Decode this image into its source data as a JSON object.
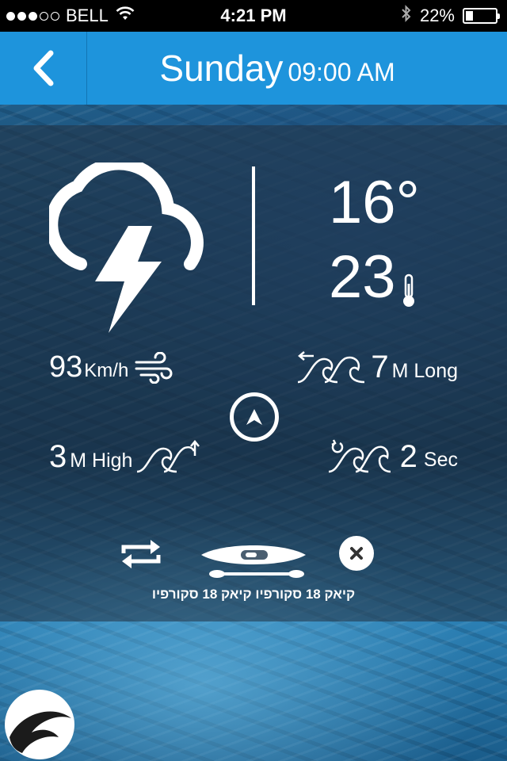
{
  "status_bar": {
    "carrier": "BELL",
    "time": "4:21 PM",
    "battery": "22%",
    "battery_level": 0.22,
    "signal_bars_filled": 3,
    "signal_bars_total": 5
  },
  "header": {
    "day": "Sunday",
    "time": "09:00 AM",
    "accent_color": "#1e94dc"
  },
  "weather": {
    "icon": "thunderstorm-icon",
    "temp_primary": "16°",
    "temp_secondary": "23"
  },
  "wind": {
    "value": "93",
    "unit": "Km/h"
  },
  "swell": {
    "value": "7",
    "unit": "M Long"
  },
  "wave_height": {
    "value": "3",
    "unit": "M High"
  },
  "wave_period": {
    "value": "2",
    "unit": "Sec"
  },
  "activity": {
    "label": "קיאק 18 סקורפיו קיאק 18 סקורפיו"
  }
}
